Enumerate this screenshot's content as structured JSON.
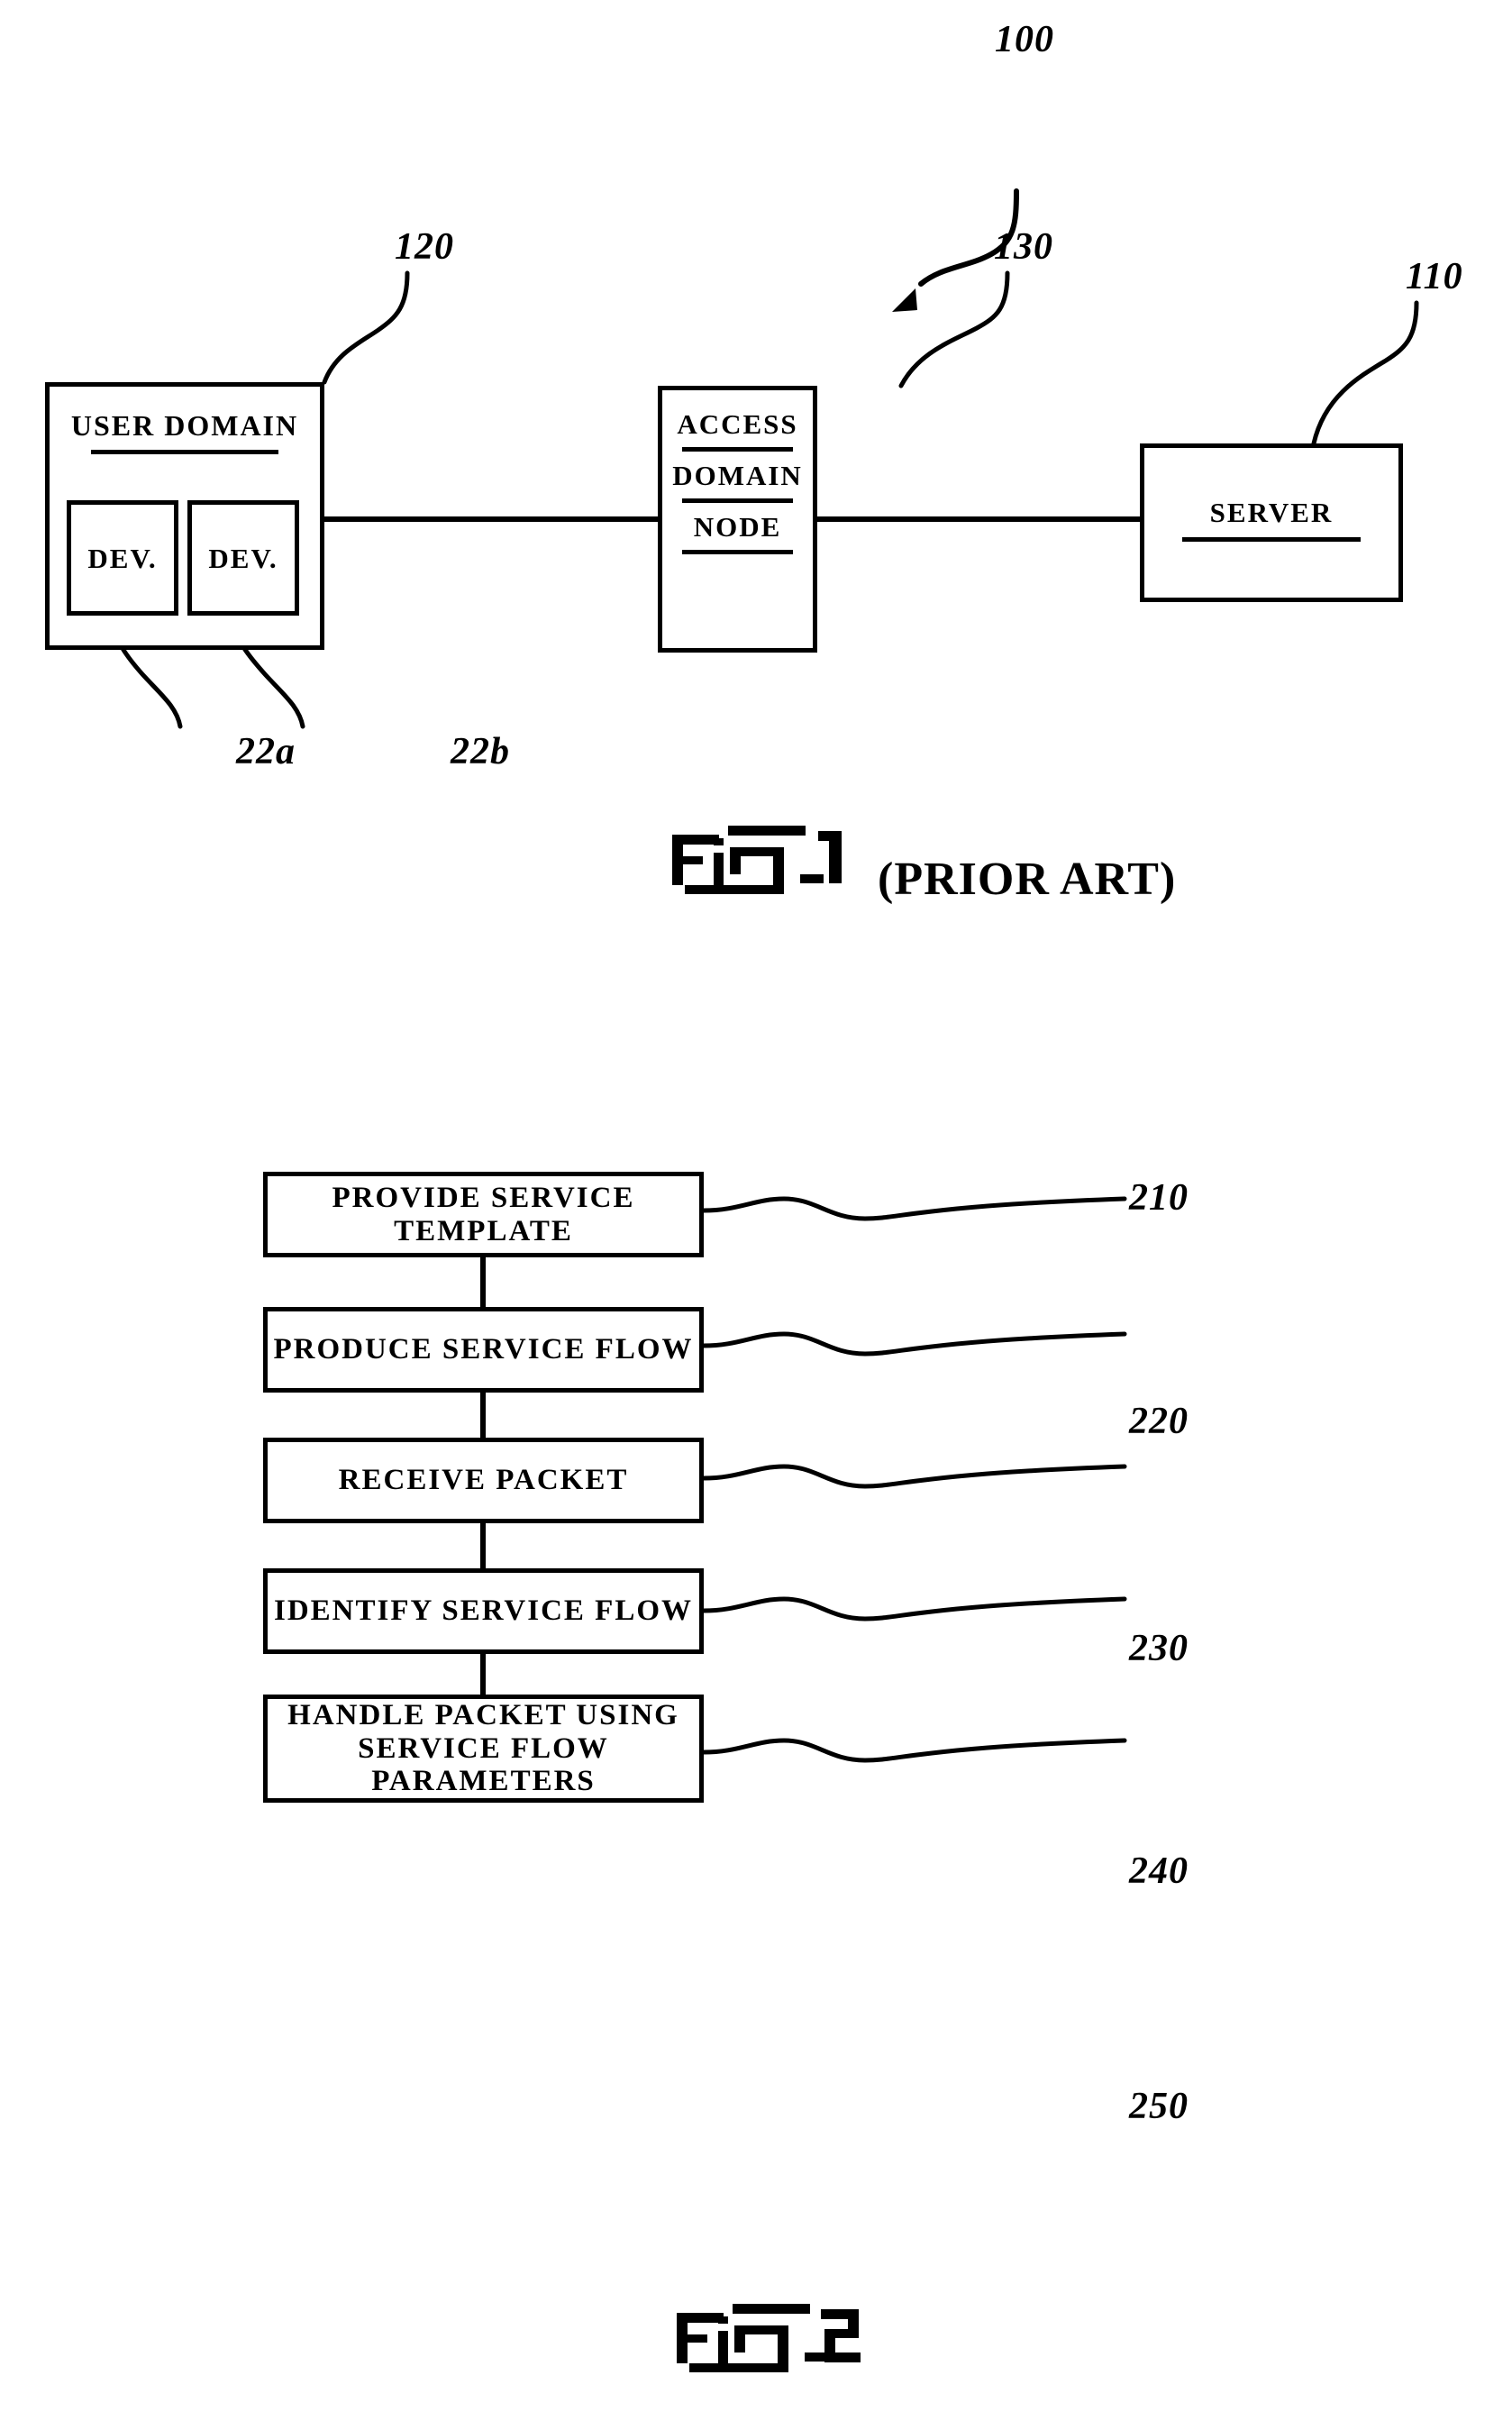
{
  "figure1": {
    "caption": {
      "fig_word": "Fig",
      "fig_number": "- 1",
      "note": "(PRIOR ART)"
    },
    "system_ref": "100",
    "blocks": [
      {
        "id": "user-domain",
        "title": "USER DOMAIN",
        "ref": "120",
        "children": [
          {
            "id": "dev-a",
            "title": "DEV.",
            "ref": "22a"
          },
          {
            "id": "dev-b",
            "title": "DEV.",
            "ref": "22b"
          }
        ]
      },
      {
        "id": "access-domain-node",
        "lines": [
          "ACCESS",
          "DOMAIN",
          "NODE"
        ],
        "ref": "130"
      },
      {
        "id": "server",
        "title": "SERVER",
        "ref": "110"
      }
    ]
  },
  "figure2": {
    "caption": {
      "fig_word": "Fig",
      "fig_number": "- 2"
    },
    "steps": [
      {
        "ref": "210",
        "label": "PROVIDE  SERVICE  TEMPLATE"
      },
      {
        "ref": "220",
        "label": "PRODUCE  SERVICE  FLOW"
      },
      {
        "ref": "230",
        "label": "RECEIVE  PACKET"
      },
      {
        "ref": "240",
        "label": "IDENTIFY  SERVICE  FLOW"
      },
      {
        "ref": "250",
        "label": "HANDLE  PACKET  USING\nSERVICE  FLOW  PARAMETERS"
      }
    ]
  },
  "colors": {
    "ink": "#000000",
    "paper": "#ffffff"
  }
}
